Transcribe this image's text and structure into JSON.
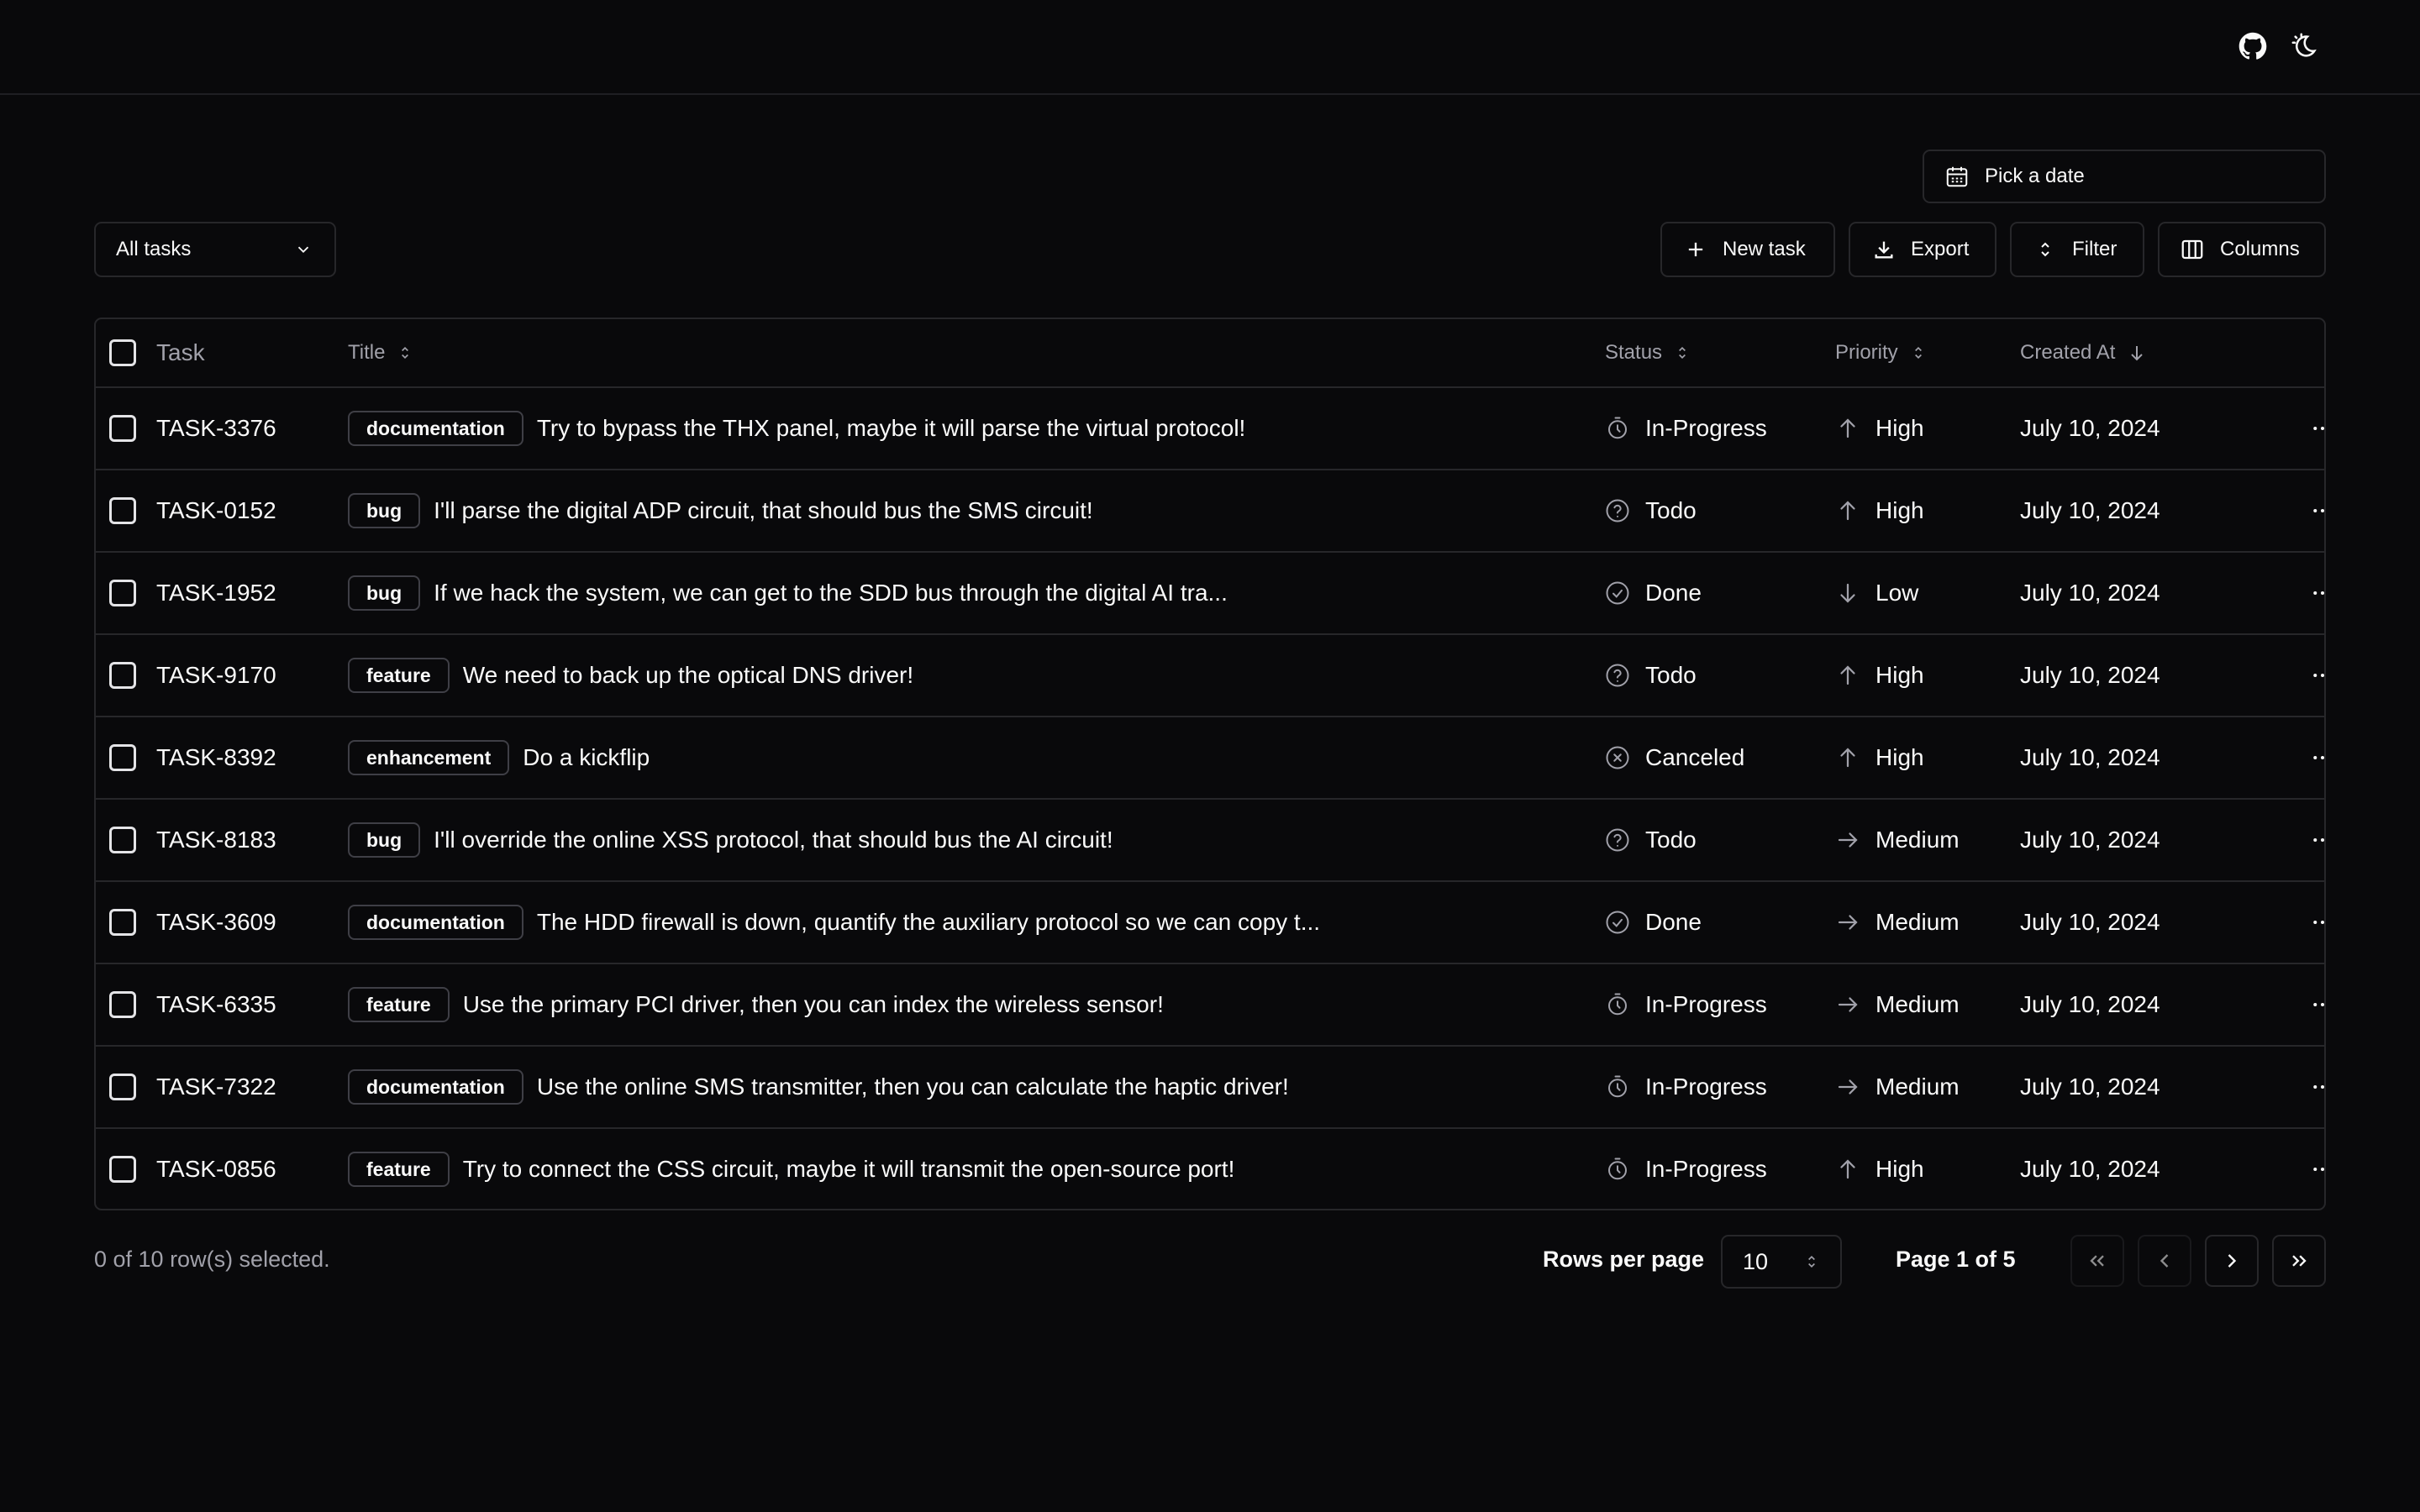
{
  "header": {
    "icons": [
      "github-icon",
      "theme-toggle-icon"
    ]
  },
  "toolbar": {
    "date_picker_label": "Pick a date",
    "view_select": "All tasks",
    "new_task_label": "New task",
    "export_label": "Export",
    "filter_label": "Filter",
    "columns_label": "Columns"
  },
  "table": {
    "headers": {
      "task": "Task",
      "title": "Title",
      "status": "Status",
      "priority": "Priority",
      "created_at": "Created At"
    },
    "rows": [
      {
        "id": "TASK-3376",
        "label": "documentation",
        "title": "Try to bypass the THX panel, maybe it will parse the virtual protocol!",
        "status": "In-Progress",
        "status_icon": "stopwatch-icon",
        "priority": "High",
        "priority_icon": "arrow-up-icon",
        "created": "July 10, 2024"
      },
      {
        "id": "TASK-0152",
        "label": "bug",
        "title": "I'll parse the digital ADP circuit, that should bus the SMS circuit!",
        "status": "Todo",
        "status_icon": "question-circle-icon",
        "priority": "High",
        "priority_icon": "arrow-up-icon",
        "created": "July 10, 2024"
      },
      {
        "id": "TASK-1952",
        "label": "bug",
        "title": "If we hack the system, we can get to the SDD bus through the digital AI tra...",
        "status": "Done",
        "status_icon": "check-circle-icon",
        "priority": "Low",
        "priority_icon": "arrow-down-icon",
        "created": "July 10, 2024"
      },
      {
        "id": "TASK-9170",
        "label": "feature",
        "title": "We need to back up the optical DNS driver!",
        "status": "Todo",
        "status_icon": "question-circle-icon",
        "priority": "High",
        "priority_icon": "arrow-up-icon",
        "created": "July 10, 2024"
      },
      {
        "id": "TASK-8392",
        "label": "enhancement",
        "title": "Do a kickflip",
        "status": "Canceled",
        "status_icon": "x-circle-icon",
        "priority": "High",
        "priority_icon": "arrow-up-icon",
        "created": "July 10, 2024"
      },
      {
        "id": "TASK-8183",
        "label": "bug",
        "title": "I'll override the online XSS protocol, that should bus the AI circuit!",
        "status": "Todo",
        "status_icon": "question-circle-icon",
        "priority": "Medium",
        "priority_icon": "arrow-right-icon",
        "created": "July 10, 2024"
      },
      {
        "id": "TASK-3609",
        "label": "documentation",
        "title": "The HDD firewall is down, quantify the auxiliary protocol so we can copy t...",
        "status": "Done",
        "status_icon": "check-circle-icon",
        "priority": "Medium",
        "priority_icon": "arrow-right-icon",
        "created": "July 10, 2024"
      },
      {
        "id": "TASK-6335",
        "label": "feature",
        "title": "Use the primary PCI driver, then you can index the wireless sensor!",
        "status": "In-Progress",
        "status_icon": "stopwatch-icon",
        "priority": "Medium",
        "priority_icon": "arrow-right-icon",
        "created": "July 10, 2024"
      },
      {
        "id": "TASK-7322",
        "label": "documentation",
        "title": "Use the online SMS transmitter, then you can calculate the haptic driver!",
        "status": "In-Progress",
        "status_icon": "stopwatch-icon",
        "priority": "Medium",
        "priority_icon": "arrow-right-icon",
        "created": "July 10, 2024"
      },
      {
        "id": "TASK-0856",
        "label": "feature",
        "title": "Try to connect the CSS circuit, maybe it will transmit the open-source port!",
        "status": "In-Progress",
        "status_icon": "stopwatch-icon",
        "priority": "High",
        "priority_icon": "arrow-up-icon",
        "created": "July 10, 2024"
      }
    ]
  },
  "footer": {
    "selection_text": "0 of 10 row(s) selected.",
    "rows_per_page_label": "Rows per page",
    "rows_per_page_value": "10",
    "page_text": "Page 1 of 5"
  }
}
